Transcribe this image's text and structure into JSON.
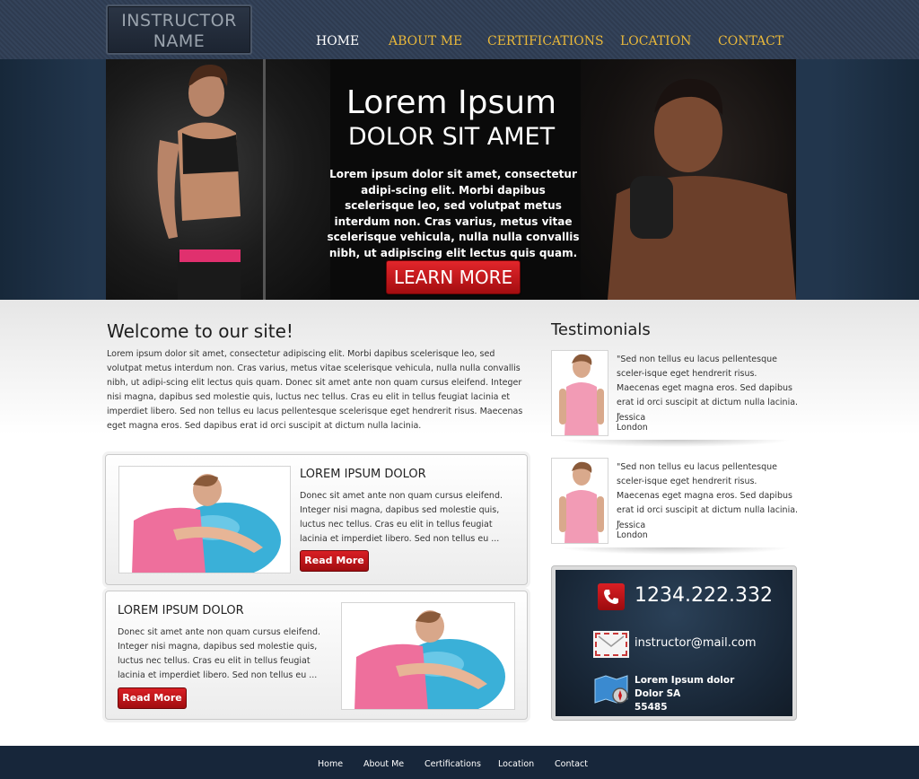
{
  "header": {
    "logo": {
      "line1": "INSTRUCTOR",
      "line2": "NAME"
    },
    "nav": [
      {
        "label": "HOME",
        "active": true
      },
      {
        "label": "ABOUT ME",
        "active": false
      },
      {
        "label": "CERTIFICATIONS",
        "active": false
      },
      {
        "label": "LOCATION",
        "active": false
      },
      {
        "label": "CONTACT",
        "active": false
      }
    ],
    "accent_color": "#e9b83a"
  },
  "hero": {
    "title": "Lorem Ipsum",
    "subtitle": "DOLOR SIT AMET",
    "text": "Lorem ipsum dolor sit amet, consectetur adipi-scing elit. Morbi dapibus scelerisque leo, sed volutpat metus interdum non. Cras varius, metus vitae scelerisque vehicula, nulla nulla convallis nibh, ut adipiscing elit lectus quis quam.",
    "button": "LEARN MORE"
  },
  "welcome": {
    "heading": "Welcome to our site!",
    "text": "Lorem ipsum dolor sit amet, consectetur adipiscing elit. Morbi dapibus scelerisque leo, sed volutpat metus interdum non. Cras varius, metus vitae scelerisque vehicula, nulla nulla convallis nibh, ut adipi-scing elit lectus quis quam. Donec sit amet ante non quam cursus eleifend. Integer nisi magna, dapibus sed molestie quis, luctus nec tellus. Cras eu elit in tellus feugiat lacinia et imperdiet libero. Sed non tellus eu lacus pellentesque scelerisque eget hendrerit risus. Maecenas eget magna eros. Sed dapibus erat id orci suscipit at dictum nulla lacinia."
  },
  "cards": [
    {
      "title": "LOREM IPSUM DOLOR",
      "text": "Donec sit amet ante non quam cursus eleifend. Integer nisi magna, dapibus sed molestie quis, luctus nec tellus. Cras eu elit in tellus feugiat lacinia et imperdiet libero. Sed non tellus eu ...",
      "button": "Read More"
    },
    {
      "title": "LOREM IPSUM DOLOR",
      "text": "Donec sit amet ante non quam cursus eleifend. Integer nisi magna, dapibus sed molestie quis, luctus nec tellus. Cras eu elit in tellus feugiat lacinia et imperdiet libero. Sed non tellus eu ...",
      "button": "Read More"
    }
  ],
  "testimonials": {
    "heading": "Testimonials",
    "items": [
      {
        "quote": "\"Sed non tellus eu lacus pellentesque sceler-isque eget hendrerit risus. Maecenas eget magna eros. Sed dapibus erat id orci suscipit at dictum nulla lacinia. \"",
        "name": "Jessica",
        "city": "London"
      },
      {
        "quote": "\"Sed non tellus eu lacus pellentesque sceler-isque eget hendrerit risus. Maecenas eget magna eros. Sed dapibus erat id orci suscipit at dictum nulla lacinia. \"",
        "name": "Jessica",
        "city": "London"
      }
    ]
  },
  "contact": {
    "phone": "1234.222.332",
    "email": "instructor@mail.com",
    "address": [
      "Lorem Ipsum dolor",
      "Dolor SA",
      "55485"
    ],
    "icons": [
      "phone-icon",
      "envelope-icon",
      "map-icon"
    ]
  },
  "footer": {
    "links": [
      "Home",
      "About Me",
      "Certifications",
      "Location",
      "Contact"
    ]
  },
  "colors": {
    "button_red": "#c8161b",
    "footer_bg": "#17263a"
  }
}
